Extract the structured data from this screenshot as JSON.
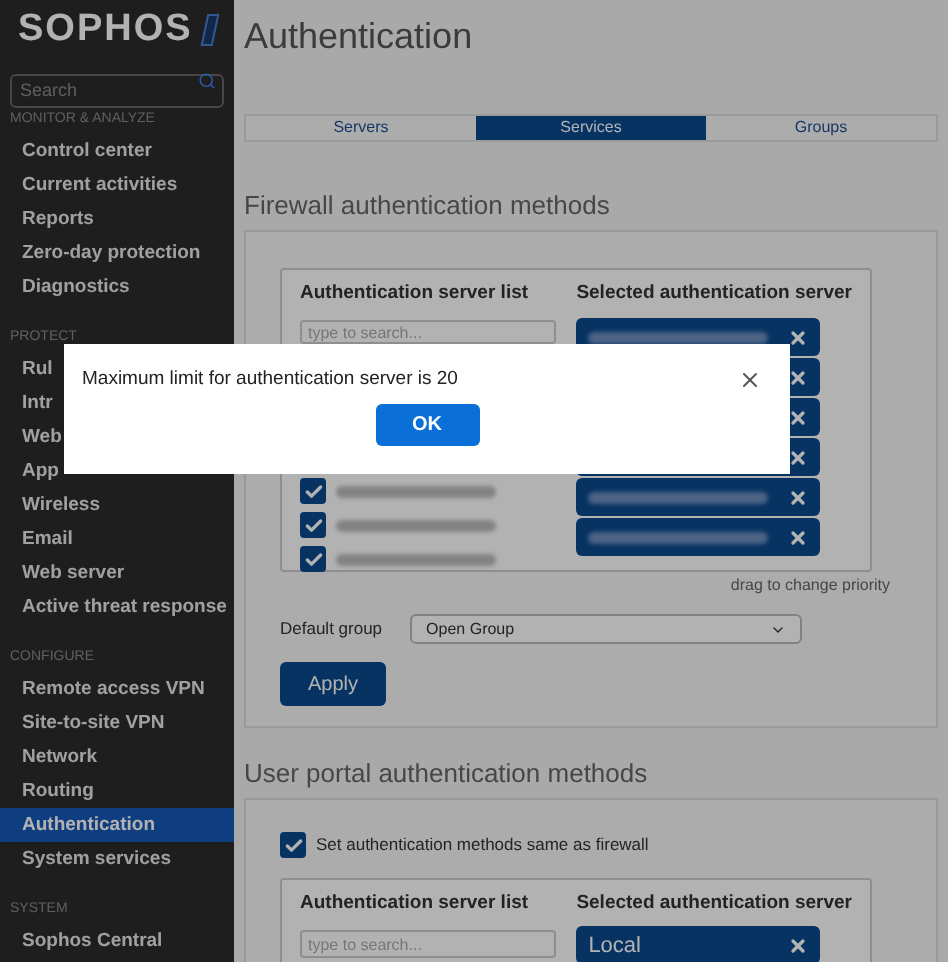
{
  "sidebar": {
    "logo": "SOPHOS",
    "search_placeholder": "Search",
    "sections": [
      {
        "title": "MONITOR & ANALYZE",
        "items": [
          {
            "label": "Control center",
            "selected": false
          },
          {
            "label": "Current activities",
            "selected": false
          },
          {
            "label": "Reports",
            "selected": false
          },
          {
            "label": "Zero-day protection",
            "selected": false
          },
          {
            "label": "Diagnostics",
            "selected": false
          }
        ]
      },
      {
        "title": "PROTECT",
        "items": [
          {
            "label": "Rul",
            "selected": false
          },
          {
            "label": "Intr",
            "selected": false
          },
          {
            "label": "Web",
            "selected": false
          },
          {
            "label": "App",
            "selected": false
          },
          {
            "label": "Wireless",
            "selected": false
          },
          {
            "label": "Email",
            "selected": false
          },
          {
            "label": "Web server",
            "selected": false
          },
          {
            "label": "Active threat response",
            "selected": false
          }
        ]
      },
      {
        "title": "CONFIGURE",
        "items": [
          {
            "label": "Remote access VPN",
            "selected": false
          },
          {
            "label": "Site-to-site VPN",
            "selected": false
          },
          {
            "label": "Network",
            "selected": false
          },
          {
            "label": "Routing",
            "selected": false
          },
          {
            "label": "Authentication",
            "selected": true
          },
          {
            "label": "System services",
            "selected": false
          }
        ]
      },
      {
        "title": "SYSTEM",
        "items": [
          {
            "label": "Sophos Central",
            "selected": false
          }
        ]
      }
    ]
  },
  "page_title": "Authentication",
  "tabs": [
    {
      "label": "Servers",
      "selected": false
    },
    {
      "label": "Services",
      "selected": true
    },
    {
      "label": "Groups",
      "selected": false
    }
  ],
  "firewall": {
    "title": "Firewall authentication methods",
    "server_list": {
      "heading": "Authentication server list",
      "search_placeholder": "type to search...",
      "items": [
        {
          "checked": true
        },
        {
          "checked": true
        },
        {
          "checked": true
        }
      ]
    },
    "selected_servers": {
      "heading": "Selected authentication server",
      "items": [
        {
          "kind": "blurred"
        },
        {
          "kind": "covered"
        },
        {
          "kind": "covered"
        },
        {
          "kind": "covered"
        },
        {
          "kind": "blurred"
        },
        {
          "kind": "blurred"
        }
      ]
    },
    "hint": "drag to change priority",
    "default_group": {
      "label": "Default group",
      "value": "Open Group"
    },
    "apply": "Apply"
  },
  "user_portal": {
    "title": "User portal authentication methods",
    "same_as_firewall": {
      "label": "Set authentication methods same as firewall",
      "checked": true
    },
    "server_list": {
      "heading": "Authentication server list",
      "search_placeholder": "type to search..."
    },
    "selected_servers": {
      "heading": "Selected authentication server",
      "items": [
        {
          "kind": "text",
          "label": "Local"
        }
      ]
    }
  },
  "dialog": {
    "message": "Maximum limit for authentication server is 20",
    "ok": "OK"
  }
}
